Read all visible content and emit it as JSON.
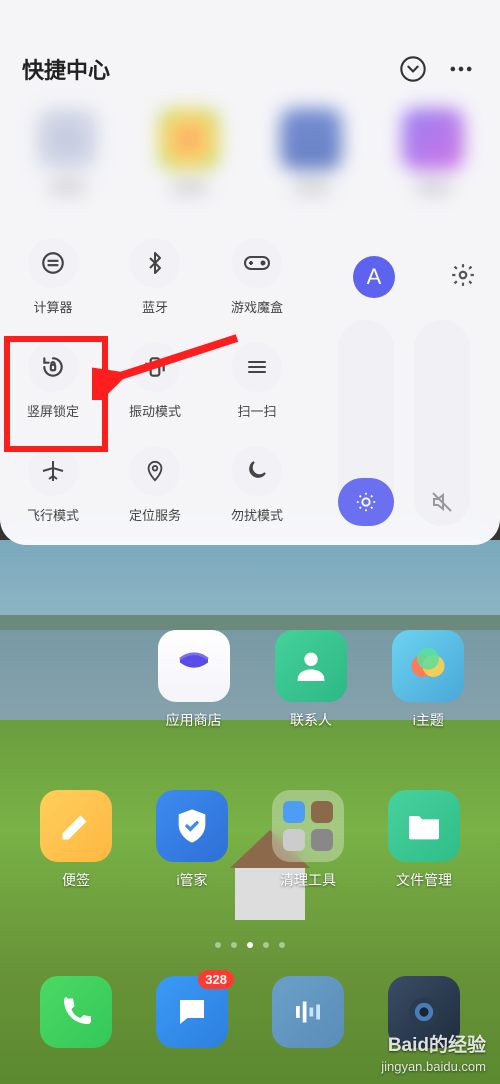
{
  "panel": {
    "title": "快捷中心",
    "items": [
      {
        "label": "计算器",
        "icon": "calc"
      },
      {
        "label": "蓝牙",
        "icon": "bluetooth"
      },
      {
        "label": "游戏魔盒",
        "icon": "gamepad"
      },
      {
        "label": "竖屏锁定",
        "icon": "rotlock"
      },
      {
        "label": "振动模式",
        "icon": "vibrate"
      },
      {
        "label": "扫一扫",
        "icon": "scan"
      },
      {
        "label": "飞行模式",
        "icon": "airplane"
      },
      {
        "label": "定位服务",
        "icon": "location"
      },
      {
        "label": "勿扰模式",
        "icon": "moon"
      }
    ],
    "a_chip": "A"
  },
  "home_row1": [
    {
      "label": "应用商店",
      "color": "linear-gradient(135deg,#ffffff,#f0f0f5)"
    },
    {
      "label": "联系人",
      "color": "linear-gradient(135deg,#45d19a,#2db885)"
    },
    {
      "label": "i主题",
      "color": "linear-gradient(135deg,#55c0e8,#4aa8d8)"
    }
  ],
  "home_row2": [
    {
      "label": "便签",
      "color": "linear-gradient(135deg,#ffcf5b,#ffb742)"
    },
    {
      "label": "i管家",
      "color": "linear-gradient(135deg,#3c8cf0,#2f6fd6)"
    },
    {
      "label": "清理工具",
      "color": "rgba(255,255,255,.30)"
    },
    {
      "label": "文件管理",
      "color": "linear-gradient(135deg,#48d19e,#2fbd88)"
    }
  ],
  "dock": [
    {
      "color": "linear-gradient(135deg,#4cd964,#34c759)"
    },
    {
      "color": "linear-gradient(135deg,#3b9af5,#2d7fe0)",
      "badge": "328"
    },
    {
      "color": "linear-gradient(135deg,#6aa0c8,#5a8db9)"
    },
    {
      "color": "linear-gradient(135deg,#2e4055,#1f2d3d)"
    }
  ],
  "watermark": {
    "brand": "Baid的经验",
    "sub": "jingyan.baidu.com"
  }
}
